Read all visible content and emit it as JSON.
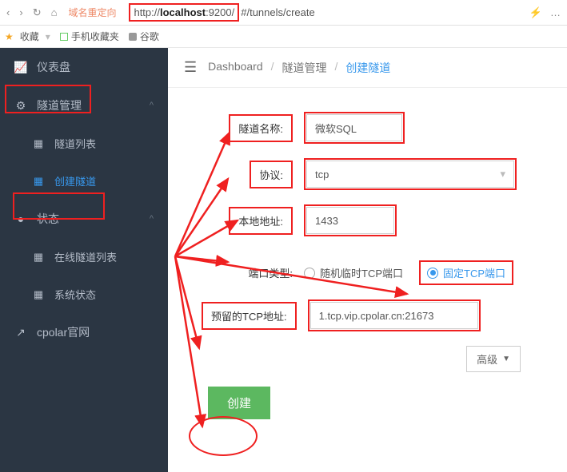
{
  "browser": {
    "redirect_label": "域名重定向",
    "url_prefix": "http://",
    "url_host": "localhost",
    "url_port": ":9200/",
    "url_path": "#/tunnels/create"
  },
  "bookmarks": {
    "fav": "收藏",
    "mobile_fav": "手机收藏夹",
    "google": "谷歌"
  },
  "sidebar": {
    "dashboard": "仪表盘",
    "tunnel_mgmt": "隧道管理",
    "tunnel_list": "隧道列表",
    "create_tunnel": "创建隧道",
    "status": "状态",
    "online_list": "在线隧道列表",
    "system_status": "系统状态",
    "cpolar_site": "cpolar官网"
  },
  "breadcrumb": {
    "dashboard": "Dashboard",
    "tunnel_mgmt": "隧道管理",
    "create_tunnel": "创建隧道"
  },
  "form": {
    "name_label": "隧道名称:",
    "name_value": "微软SQL",
    "protocol_label": "协议:",
    "protocol_value": "tcp",
    "local_addr_label": "本地地址:",
    "local_addr_value": "1433",
    "port_type_label": "端口类型:",
    "port_random": "随机临时TCP端口",
    "port_fixed": "固定TCP端口",
    "reserved_label": "预留的TCP地址:",
    "reserved_value": "1.tcp.vip.cpolar.cn:21673",
    "advanced": "高级",
    "create": "创建"
  }
}
